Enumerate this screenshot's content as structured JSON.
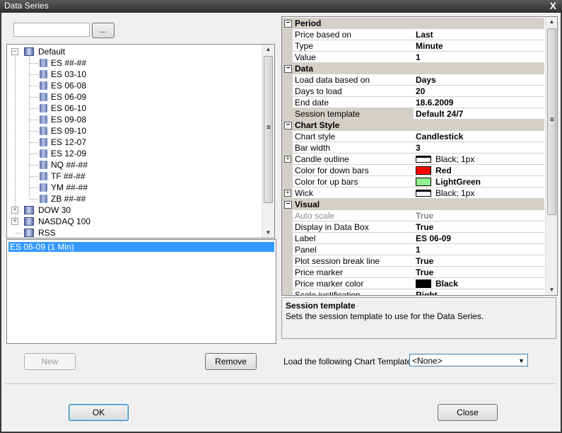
{
  "window": {
    "title": "Data Series",
    "close_glyph": "X"
  },
  "search": {
    "value": "",
    "browse_label": "..."
  },
  "tree": {
    "root": {
      "label": "Default",
      "expander": "−"
    },
    "children": [
      "ES ##-##",
      "ES 03-10",
      "ES 06-08",
      "ES 06-09",
      "ES 06-10",
      "ES 09-08",
      "ES 09-10",
      "ES 12-07",
      "ES 12-09",
      "NQ ##-##",
      "TF ##-##",
      "YM ##-##",
      "ZB ##-##"
    ],
    "groups": [
      {
        "label": "DOW 30",
        "expander": "+"
      },
      {
        "label": "NASDAQ 100",
        "expander": "+"
      },
      {
        "label": "RSS",
        "expander": ""
      }
    ]
  },
  "selected_series": [
    "ES 06-09 (1 Min)"
  ],
  "buttons": {
    "new": "New",
    "remove": "Remove",
    "ok": "OK",
    "close": "Close"
  },
  "properties": {
    "period": {
      "title": "Period",
      "rows": [
        {
          "name": "Price based on",
          "value": "Last"
        },
        {
          "name": "Type",
          "value": "Minute"
        },
        {
          "name": "Value",
          "value": "1"
        }
      ]
    },
    "data": {
      "title": "Data",
      "rows": [
        {
          "name": "Load data based on",
          "value": "Days"
        },
        {
          "name": "Days to load",
          "value": "20"
        },
        {
          "name": "End date",
          "value": "18.6.2009"
        },
        {
          "name": "Session template",
          "value": "Default 24/7"
        }
      ]
    },
    "chart_style": {
      "title": "Chart Style",
      "rows": [
        {
          "name": "Chart style",
          "value": "Candlestick"
        },
        {
          "name": "Bar width",
          "value": "3"
        },
        {
          "name": "Candle outline",
          "value": "Black; 1px"
        },
        {
          "name": "Color for down bars",
          "value": "Red"
        },
        {
          "name": "Color for up bars",
          "value": "LightGreen"
        },
        {
          "name": "Wick",
          "value": "Black; 1px"
        }
      ]
    },
    "visual": {
      "title": "Visual",
      "rows": [
        {
          "name": "Auto scale",
          "value": "True"
        },
        {
          "name": "Display in Data Box",
          "value": "True"
        },
        {
          "name": "Label",
          "value": "ES 06-09"
        },
        {
          "name": "Panel",
          "value": "1"
        },
        {
          "name": "Plot session break line",
          "value": "True"
        },
        {
          "name": "Price marker",
          "value": "True"
        },
        {
          "name": "Price marker color",
          "value": "Black"
        },
        {
          "name": "Scale justification",
          "value": "Right"
        }
      ]
    },
    "collapse_glyph": "−",
    "expand_glyph": "+"
  },
  "colors": {
    "down_bars": "#ff0000",
    "up_bars": "#90ee90",
    "outline": "#000000",
    "price_marker": "#000000",
    "selection": "#3399ff"
  },
  "description": {
    "title": "Session template",
    "text": "Sets the session template to use for the Data Series."
  },
  "template": {
    "label": "Load the following Chart Template:",
    "selected": "<None>",
    "arrow": "▼"
  },
  "scroll": {
    "up": "▲",
    "down": "▼",
    "grip": "≡"
  }
}
